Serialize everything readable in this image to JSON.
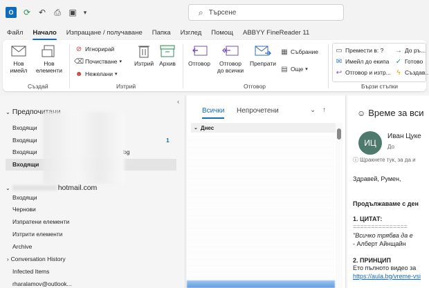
{
  "search": {
    "placeholder": "Търсене"
  },
  "menu": [
    "Файл",
    "Начало",
    "Изпращане / получаване",
    "Папка",
    "Изглед",
    "Помощ",
    "ABBYY FineReader 11"
  ],
  "ribbon": {
    "new_email": [
      "Нов",
      "имейл"
    ],
    "new_items": [
      "Нов",
      "елементи"
    ],
    "ignore": "Игнорирай",
    "cleanup": "Почистване",
    "junk": "Нежелани",
    "delete": "Изтрий",
    "archive": "Архив",
    "reply": "Отговор",
    "reply_all": [
      "Отговор",
      "до всички"
    ],
    "forward": "Препрати",
    "meeting": "Събрание",
    "more": "Още",
    "group_new": "Създай",
    "group_delete": "Изтрий",
    "group_respond": "Отговор",
    "group_quicksteps": "Бързи стъпки",
    "qs_move": "Премести в: ?",
    "qs_team": "Имейл до екипа",
    "qs_reply_delete": "Отговор и изтр...",
    "qs_to_manager": "До ръ...",
    "qs_done": "Готово",
    "qs_create": "Създав..."
  },
  "folders": {
    "account1": "Предпочитани",
    "fav_items": [
      "Входящи",
      "Входящи",
      "Входящи",
      "Входящи"
    ],
    "fav_count": "1",
    "fav_suffix": "bg",
    "account2": "hotmail.com",
    "items": [
      "Входящи",
      "Чернови",
      "Изпратени елементи",
      "Изтрити елементи",
      "Archive",
      "Conversation History",
      "Infected Items",
      "rharalamov@outlook..."
    ]
  },
  "list": {
    "tab_all": "Всички",
    "tab_unread": "Непрочетени",
    "group_today": "Днес"
  },
  "reading": {
    "subject": "Време за вси",
    "sender": "Иван Цуке",
    "avatar": "ИЦ",
    "to": "До",
    "info": "Щракнете тук, за да и",
    "greeting": "Здравей, Румен,",
    "continue": "Продължаваме с ден",
    "s1": "1. ЦИТАТ:",
    "eq": "===============",
    "quote": "\"Всичко трябва да е",
    "author": "- Алберт Айнщайн",
    "s2": "2. ПРИНЦИП",
    "video": "Ето пълното видео за",
    "link": "https://aula.bg/vreme-vsi"
  },
  "colors": {
    "accent": "#0f6cbd",
    "avatar": "#4e7a6e"
  }
}
